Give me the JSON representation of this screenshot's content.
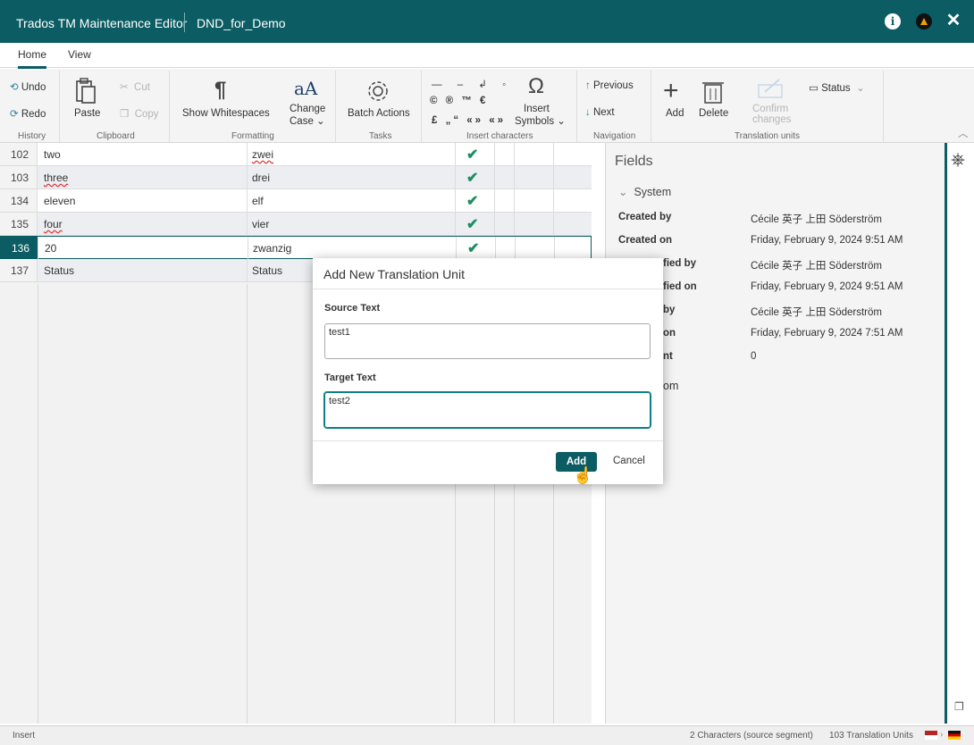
{
  "title_bar": {
    "app_name": "Trados TM Maintenance Editor",
    "document": "DND_for_Demo"
  },
  "tabs": [
    {
      "label": "Home"
    },
    {
      "label": "View"
    }
  ],
  "ribbon": {
    "history": {
      "undo": "Undo",
      "redo": "Redo",
      "group": "History"
    },
    "clipboard": {
      "paste": "Paste",
      "cut": "Cut",
      "copy": "Copy",
      "group": "Clipboard"
    },
    "formatting": {
      "show_whitespaces": "Show Whitespaces",
      "change_case_1": "Change",
      "change_case_2": "Case",
      "group": "Formatting"
    },
    "tasks": {
      "batch_actions": "Batch Actions",
      "group": "Tasks"
    },
    "insert_characters": {
      "insert_symbols_1": "Insert",
      "insert_symbols_2": "Symbols",
      "group": "Insert characters"
    },
    "navigation": {
      "previous": "Previous",
      "next": "Next",
      "group": "Navigation"
    },
    "translation_units": {
      "add": "Add",
      "delete": "Delete",
      "confirm_1": "Confirm",
      "confirm_2": "changes",
      "status": "Status",
      "group": "Translation units"
    }
  },
  "rows": [
    {
      "num": "102",
      "source": "two",
      "target": "zwei"
    },
    {
      "num": "103",
      "source": "three",
      "target": "drei"
    },
    {
      "num": "134",
      "source": "eleven",
      "target": "elf"
    },
    {
      "num": "135",
      "source": "four",
      "target": "vier"
    },
    {
      "num": "136",
      "source": "20",
      "target": "zwanzig"
    },
    {
      "num": "137",
      "source": "Status",
      "target": "Status"
    }
  ],
  "fields": {
    "title": "Fields",
    "section": "System",
    "items": [
      {
        "label": "Created by",
        "value": "Cécile 英子 上田 Söderström"
      },
      {
        "label": "Created on",
        "value": "Friday, February 9, 2024 9:51 AM"
      },
      {
        "label": "fied by",
        "value": "Cécile 英子 上田 Söderström"
      },
      {
        "label": "fied on",
        "value": "Friday, February 9, 2024 9:51 AM"
      },
      {
        "label": "by",
        "value": "Cécile 英子 上田 Söderström"
      },
      {
        "label": "on",
        "value": "Friday, February 9, 2024 7:51 AM"
      },
      {
        "label": "nt",
        "value": "0"
      },
      {
        "label": "om",
        "value": ""
      }
    ]
  },
  "modal": {
    "title": "Add New Translation Unit",
    "source_label": "Source Text",
    "source_value": "test1",
    "target_label": "Target Text",
    "target_value": "test2",
    "add": "Add",
    "cancel": "Cancel"
  },
  "status_bar": {
    "mode": "Insert",
    "chars": "2 Characters (source segment)",
    "units": "103 Translation Units"
  },
  "colors": {
    "accent": "#0b5c63",
    "check": "#1a8f62"
  }
}
